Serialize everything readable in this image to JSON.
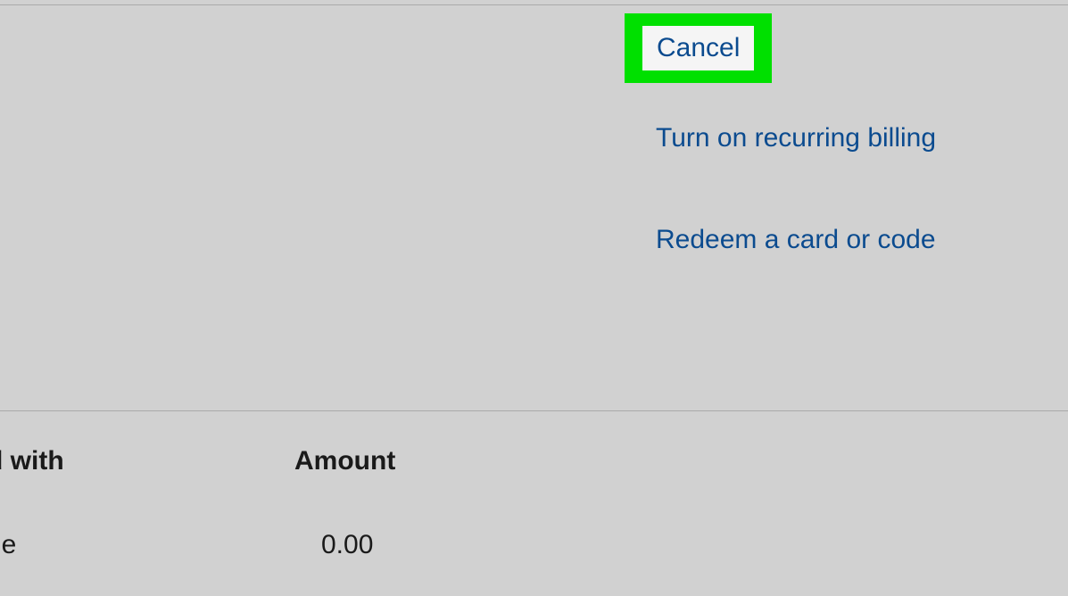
{
  "actions": {
    "cancel_label": "Cancel",
    "recurring_billing_label": "Turn on recurring billing",
    "redeem_label": "Redeem a card or code"
  },
  "table": {
    "header_1": "d with",
    "header_2": "Amount",
    "row_1_col_1": "ne",
    "row_1_col_2": "0.00"
  }
}
